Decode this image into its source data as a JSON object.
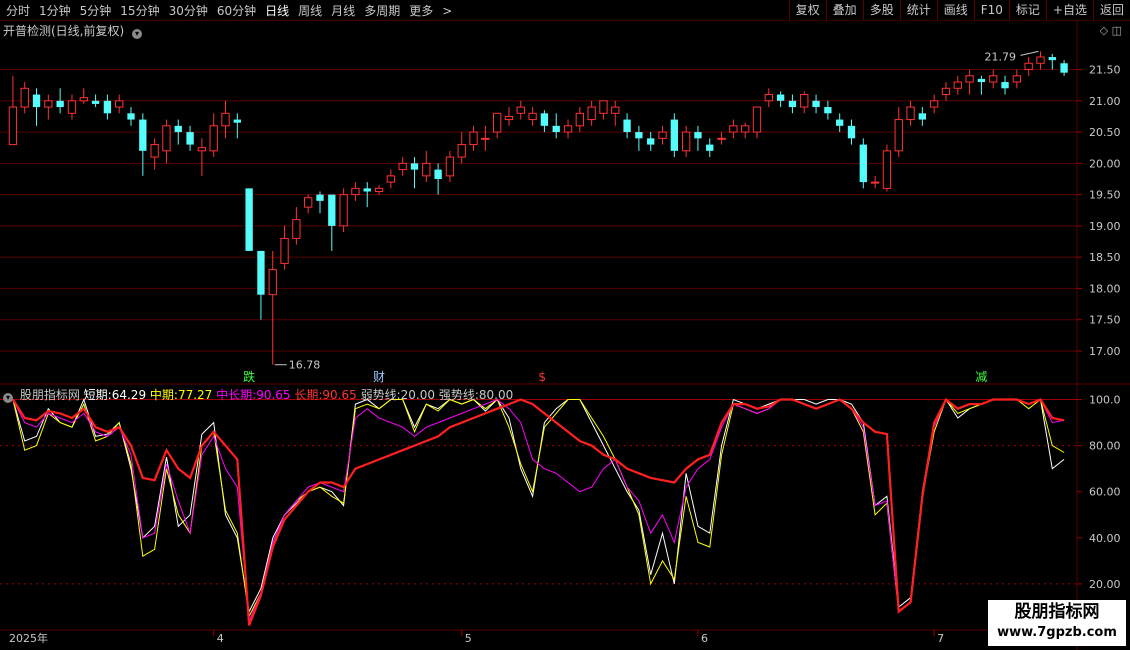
{
  "toolbar": {
    "periods": [
      "分时",
      "1分钟",
      "5分钟",
      "15分钟",
      "30分钟",
      "60分钟",
      "日线",
      "周线",
      "月线",
      "多周期",
      "更多"
    ],
    "active_period": "日线",
    "more_arrow": ">",
    "right_buttons": [
      "复权",
      "叠加",
      "多股",
      "统计",
      "画线",
      "F10",
      "标记",
      "+自选",
      "返回"
    ]
  },
  "main_header": {
    "title": "开普检测(日线,前复权)"
  },
  "indicator_header": {
    "name": "股朋指标网",
    "short_label": "短期:",
    "short_value": "64.29",
    "mid_label": "中期:",
    "mid_value": "77.27",
    "midlong_label": "中长期:",
    "midlong_value": "90.65",
    "long_label": "长期:",
    "long_value": "90.65",
    "weak_label": "弱势线:",
    "weak_value": "20.00",
    "strong_label": "强势线:",
    "strong_value": "80.00"
  },
  "watermark": {
    "line1": "股朋指标网",
    "line2": "www.7gpzb.com"
  },
  "colors": {
    "up": "#ff3232",
    "down": "#54fcfc",
    "short": "#ffffff",
    "mid": "#ffff00",
    "midlong": "#ff00ff",
    "long": "#ff2020",
    "grid": "#5a0000"
  },
  "chart_data": [
    {
      "type": "candlestick",
      "price_axis": {
        "min": 16.6,
        "max": 22.1,
        "ticks": [
          "21.50",
          "21.00",
          "20.50",
          "20.00",
          "19.50",
          "19.00",
          "18.50",
          "18.00",
          "17.50",
          "17.00"
        ]
      },
      "annotations": {
        "high": "21.79",
        "low": "16.78"
      },
      "markers": [
        {
          "text": "跌",
          "bar": 20,
          "color": "#3cff3c"
        },
        {
          "text": "财",
          "bar": 31,
          "color": "#a0c8ff"
        },
        {
          "text": "$",
          "bar": 45,
          "color": "#ff3232"
        },
        {
          "text": "减",
          "bar": 82,
          "color": "#3cff3c"
        }
      ],
      "x_labels": [
        {
          "text": "2025年",
          "bar": 0
        },
        {
          "text": "4",
          "bar": 17
        },
        {
          "text": "5",
          "bar": 38
        },
        {
          "text": "6",
          "bar": 58
        },
        {
          "text": "7",
          "bar": 78
        }
      ],
      "candles": [
        [
          20.3,
          20.9,
          21.4,
          20.3
        ],
        [
          20.9,
          21.2,
          21.3,
          20.8
        ],
        [
          21.1,
          20.9,
          21.2,
          20.6
        ],
        [
          20.9,
          21.0,
          21.1,
          20.7
        ],
        [
          21.0,
          20.9,
          21.2,
          20.8
        ],
        [
          20.8,
          21.0,
          21.1,
          20.7
        ],
        [
          21.0,
          21.05,
          21.2,
          20.95
        ],
        [
          21.0,
          20.95,
          21.1,
          20.9
        ],
        [
          21.0,
          20.8,
          21.1,
          20.7
        ],
        [
          20.9,
          21.0,
          21.1,
          20.8
        ],
        [
          20.8,
          20.7,
          20.9,
          20.6
        ],
        [
          20.7,
          20.2,
          20.8,
          19.8
        ],
        [
          20.1,
          20.3,
          20.4,
          19.9
        ],
        [
          20.2,
          20.6,
          20.7,
          20.0
        ],
        [
          20.6,
          20.5,
          20.7,
          20.3
        ],
        [
          20.5,
          20.3,
          20.6,
          20.2
        ],
        [
          20.2,
          20.25,
          20.4,
          19.8
        ],
        [
          20.2,
          20.6,
          20.8,
          20.1
        ],
        [
          20.6,
          20.8,
          21.0,
          20.4
        ],
        [
          20.7,
          20.65,
          20.8,
          20.4
        ],
        [
          19.6,
          18.6,
          19.6,
          18.6
        ],
        [
          18.6,
          17.9,
          18.6,
          17.5
        ],
        [
          17.9,
          18.3,
          18.6,
          16.78
        ],
        [
          18.4,
          18.8,
          19.0,
          18.3
        ],
        [
          18.8,
          19.1,
          19.3,
          18.7
        ],
        [
          19.3,
          19.45,
          19.5,
          19.2
        ],
        [
          19.5,
          19.4,
          19.55,
          19.2
        ],
        [
          19.5,
          19.0,
          19.5,
          18.6
        ],
        [
          19.0,
          19.5,
          19.6,
          18.9
        ],
        [
          19.5,
          19.6,
          19.7,
          19.4
        ],
        [
          19.6,
          19.55,
          19.7,
          19.3
        ],
        [
          19.55,
          19.6,
          19.65,
          19.5
        ],
        [
          19.7,
          19.8,
          19.9,
          19.6
        ],
        [
          19.9,
          20.0,
          20.1,
          19.8
        ],
        [
          20.0,
          19.9,
          20.1,
          19.6
        ],
        [
          19.8,
          20.0,
          20.2,
          19.7
        ],
        [
          19.9,
          19.75,
          20.0,
          19.5
        ],
        [
          19.8,
          20.1,
          20.2,
          19.7
        ],
        [
          20.1,
          20.3,
          20.5,
          20.0
        ],
        [
          20.3,
          20.5,
          20.6,
          20.2
        ],
        [
          20.4,
          20.4,
          20.6,
          20.2
        ],
        [
          20.5,
          20.8,
          20.8,
          20.4
        ],
        [
          20.7,
          20.75,
          20.9,
          20.6
        ],
        [
          20.8,
          20.9,
          21.0,
          20.7
        ],
        [
          20.7,
          20.8,
          20.9,
          20.6
        ],
        [
          20.8,
          20.6,
          20.85,
          20.5
        ],
        [
          20.6,
          20.5,
          20.8,
          20.4
        ],
        [
          20.5,
          20.6,
          20.7,
          20.4
        ],
        [
          20.6,
          20.8,
          20.9,
          20.5
        ],
        [
          20.7,
          20.9,
          21.0,
          20.6
        ],
        [
          20.8,
          21.0,
          21.0,
          20.7
        ],
        [
          20.8,
          20.9,
          21.0,
          20.6
        ],
        [
          20.7,
          20.5,
          20.8,
          20.4
        ],
        [
          20.5,
          20.4,
          20.6,
          20.2
        ],
        [
          20.4,
          20.3,
          20.5,
          20.2
        ],
        [
          20.4,
          20.5,
          20.6,
          20.3
        ],
        [
          20.7,
          20.2,
          20.8,
          20.1
        ],
        [
          20.2,
          20.5,
          20.6,
          20.1
        ],
        [
          20.5,
          20.4,
          20.6,
          20.2
        ],
        [
          20.3,
          20.2,
          20.4,
          20.1
        ],
        [
          20.4,
          20.4,
          20.5,
          20.3
        ],
        [
          20.5,
          20.6,
          20.7,
          20.4
        ],
        [
          20.5,
          20.6,
          20.65,
          20.4
        ],
        [
          20.5,
          20.9,
          20.9,
          20.4
        ],
        [
          21.0,
          21.1,
          21.2,
          20.9
        ],
        [
          21.1,
          21.0,
          21.15,
          20.9
        ],
        [
          21.0,
          20.9,
          21.1,
          20.8
        ],
        [
          20.9,
          21.1,
          21.15,
          20.8
        ],
        [
          21.0,
          20.9,
          21.1,
          20.8
        ],
        [
          20.9,
          20.8,
          21.0,
          20.7
        ],
        [
          20.7,
          20.6,
          20.8,
          20.5
        ],
        [
          20.6,
          20.4,
          20.7,
          20.3
        ],
        [
          20.3,
          19.7,
          20.4,
          19.6
        ],
        [
          19.7,
          19.7,
          19.8,
          19.6
        ],
        [
          19.6,
          20.2,
          20.3,
          19.55
        ],
        [
          20.2,
          20.7,
          20.9,
          20.1
        ],
        [
          20.7,
          20.9,
          21.0,
          20.6
        ],
        [
          20.8,
          20.7,
          20.9,
          20.6
        ],
        [
          20.9,
          21.0,
          21.1,
          20.8
        ],
        [
          21.1,
          21.2,
          21.3,
          21.0
        ],
        [
          21.2,
          21.3,
          21.4,
          21.1
        ],
        [
          21.3,
          21.4,
          21.5,
          21.1
        ],
        [
          21.35,
          21.3,
          21.4,
          21.1
        ],
        [
          21.3,
          21.4,
          21.5,
          21.2
        ],
        [
          21.3,
          21.2,
          21.4,
          21.1
        ],
        [
          21.3,
          21.4,
          21.5,
          21.2
        ],
        [
          21.5,
          21.6,
          21.7,
          21.4
        ],
        [
          21.6,
          21.7,
          21.79,
          21.5
        ],
        [
          21.7,
          21.65,
          21.75,
          21.5
        ],
        [
          21.6,
          21.45,
          21.65,
          21.4
        ]
      ]
    },
    {
      "type": "line",
      "y_axis": {
        "min": 0,
        "max": 105,
        "ticks": [
          "100.0",
          "80.00",
          "60.00",
          "40.00",
          "20.00"
        ]
      },
      "reference_lines": [
        20,
        80,
        100
      ],
      "series": [
        {
          "name": "短期",
          "color": "#ffffff",
          "values": [
            100,
            82,
            84,
            96,
            90,
            88,
            100,
            84,
            85,
            90,
            70,
            40,
            45,
            75,
            45,
            50,
            85,
            90,
            50,
            40,
            8,
            18,
            40,
            50,
            55,
            60,
            62,
            60,
            54,
            98,
            100,
            96,
            100,
            100,
            88,
            98,
            96,
            100,
            98,
            100,
            95,
            100,
            92,
            70,
            58,
            90,
            96,
            100,
            100,
            90,
            80,
            70,
            60,
            52,
            24,
            42,
            20,
            68,
            45,
            42,
            80,
            100,
            98,
            96,
            98,
            100,
            100,
            100,
            98,
            100,
            100,
            98,
            90,
            54,
            58,
            10,
            14,
            60,
            90,
            100,
            92,
            96,
            98,
            100,
            100,
            100,
            98,
            100,
            70,
            74
          ]
        },
        {
          "name": "中期",
          "color": "#ffff00",
          "values": [
            100,
            78,
            80,
            94,
            90,
            88,
            98,
            82,
            84,
            90,
            72,
            32,
            35,
            70,
            50,
            42,
            80,
            86,
            52,
            42,
            6,
            16,
            38,
            50,
            56,
            60,
            62,
            58,
            55,
            96,
            98,
            96,
            100,
            100,
            86,
            98,
            95,
            100,
            98,
            100,
            96,
            100,
            88,
            72,
            60,
            88,
            94,
            100,
            100,
            92,
            84,
            74,
            62,
            50,
            20,
            30,
            22,
            58,
            38,
            36,
            76,
            98,
            96,
            94,
            96,
            100,
            100,
            98,
            96,
            98,
            100,
            96,
            86,
            50,
            55,
            8,
            12,
            58,
            86,
            100,
            94,
            96,
            98,
            100,
            100,
            100,
            96,
            100,
            80,
            77
          ]
        },
        {
          "name": "中长期",
          "color": "#ff00ff",
          "values": [
            100,
            90,
            88,
            94,
            92,
            90,
            94,
            86,
            84,
            88,
            76,
            40,
            42,
            72,
            56,
            42,
            76,
            84,
            70,
            62,
            4,
            16,
            38,
            50,
            56,
            62,
            64,
            62,
            60,
            92,
            96,
            92,
            90,
            88,
            84,
            88,
            90,
            92,
            94,
            96,
            98,
            100,
            96,
            90,
            74,
            70,
            68,
            64,
            60,
            62,
            70,
            74,
            62,
            56,
            42,
            50,
            38,
            62,
            70,
            74,
            88,
            98,
            96,
            94,
            96,
            100,
            100,
            98,
            96,
            98,
            100,
            96,
            88,
            54,
            56,
            8,
            12,
            58,
            88,
            100,
            96,
            98,
            98,
            100,
            100,
            100,
            98,
            100,
            90,
            91
          ]
        },
        {
          "name": "长期",
          "color": "#ff2020",
          "values": [
            100,
            92,
            91,
            95,
            94,
            92,
            96,
            88,
            86,
            88,
            80,
            66,
            65,
            78,
            70,
            66,
            80,
            86,
            80,
            74,
            2,
            15,
            36,
            48,
            54,
            60,
            64,
            64,
            62,
            70,
            72,
            74,
            76,
            78,
            80,
            82,
            84,
            88,
            90,
            92,
            94,
            96,
            98,
            100,
            98,
            94,
            90,
            86,
            82,
            80,
            76,
            74,
            70,
            68,
            66,
            65,
            64,
            70,
            74,
            76,
            90,
            98,
            98,
            96,
            97,
            100,
            100,
            98,
            96,
            98,
            100,
            96,
            90,
            86,
            85,
            8,
            12,
            58,
            90,
            100,
            96,
            98,
            98,
            100,
            100,
            100,
            98,
            100,
            92,
            91
          ]
        }
      ]
    }
  ]
}
